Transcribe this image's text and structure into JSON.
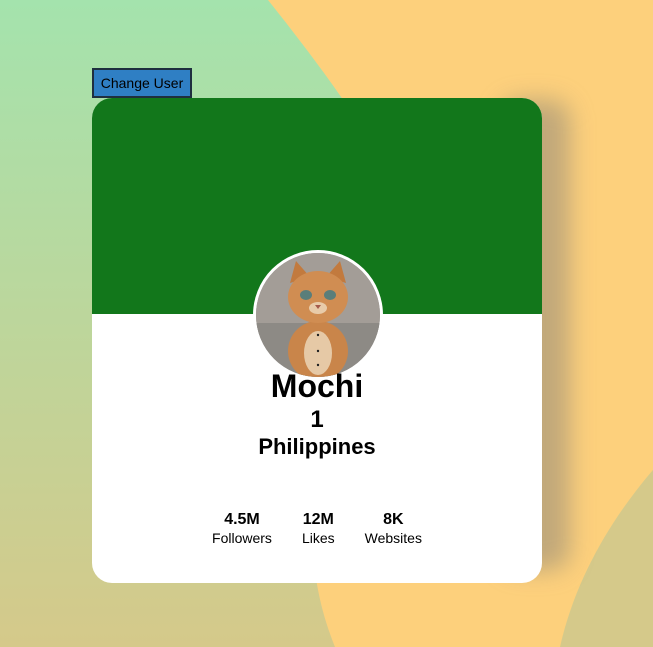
{
  "controls": {
    "change_user_label": "Change User"
  },
  "profile": {
    "name": "Mochi",
    "rank": "1",
    "country": "Philippines",
    "avatar_icon": "cat-photo"
  },
  "stats": [
    {
      "value": "4.5M",
      "label": "Followers"
    },
    {
      "value": "12M",
      "label": "Likes"
    },
    {
      "value": "8K",
      "label": "Websites"
    }
  ],
  "colors": {
    "background_orange": "#fdd07c",
    "background_green": "#a4e3ad",
    "background_olive": "#d5c98a",
    "cover_green": "#12771b",
    "button_blue": "#2f7fc4",
    "card_white": "#ffffff"
  }
}
